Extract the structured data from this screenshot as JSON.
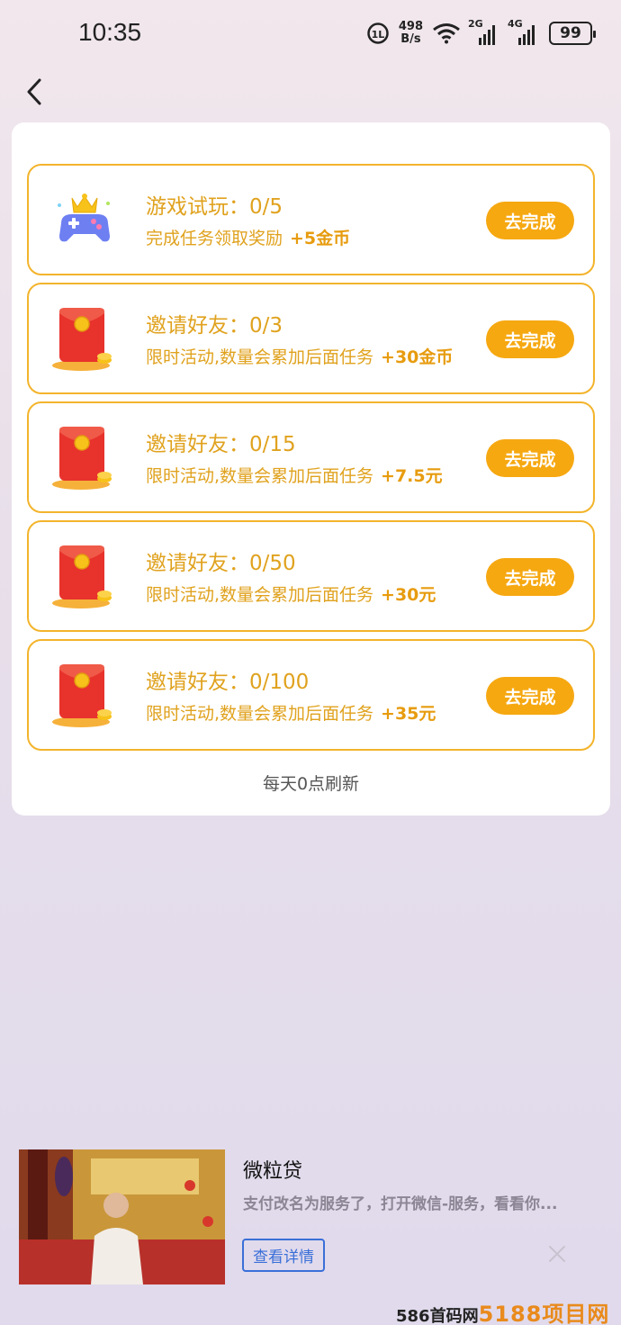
{
  "status_bar": {
    "time": "10:35",
    "net_speed_value": "498",
    "net_speed_unit": "B/s",
    "sig1_label": "2G",
    "sig2_label": "4G",
    "battery": "99"
  },
  "tasks": [
    {
      "title": "游戏试玩：0/5",
      "desc": "完成任务领取奖励",
      "reward": "+5金币",
      "button": "去完成",
      "icon": "game-controller-icon"
    },
    {
      "title": "邀请好友：0/3",
      "desc": "限时活动,数量会累加后面任务",
      "reward": "+30金币",
      "button": "去完成",
      "icon": "red-envelope-icon"
    },
    {
      "title": "邀请好友：0/15",
      "desc": "限时活动,数量会累加后面任务",
      "reward": "+7.5元",
      "button": "去完成",
      "icon": "red-envelope-icon"
    },
    {
      "title": "邀请好友：0/50",
      "desc": "限时活动,数量会累加后面任务",
      "reward": "+30元",
      "button": "去完成",
      "icon": "red-envelope-icon"
    },
    {
      "title": "邀请好友：0/100",
      "desc": "限时活动,数量会累加后面任务",
      "reward": "+35元",
      "button": "去完成",
      "icon": "red-envelope-icon"
    }
  ],
  "refresh_note": "每天0点刷新",
  "ad": {
    "title": "微粒贷",
    "desc": "支付改名为服务了，打开微信-服务，看看你...",
    "button": "查看详情"
  },
  "watermark": {
    "prefix": "586首码网",
    "brand": "5188项目网"
  },
  "colors": {
    "accent": "#f6a811",
    "task_text": "#e0a21e",
    "task_border": "#f3b42c",
    "ad_button": "#3a6fd8"
  }
}
